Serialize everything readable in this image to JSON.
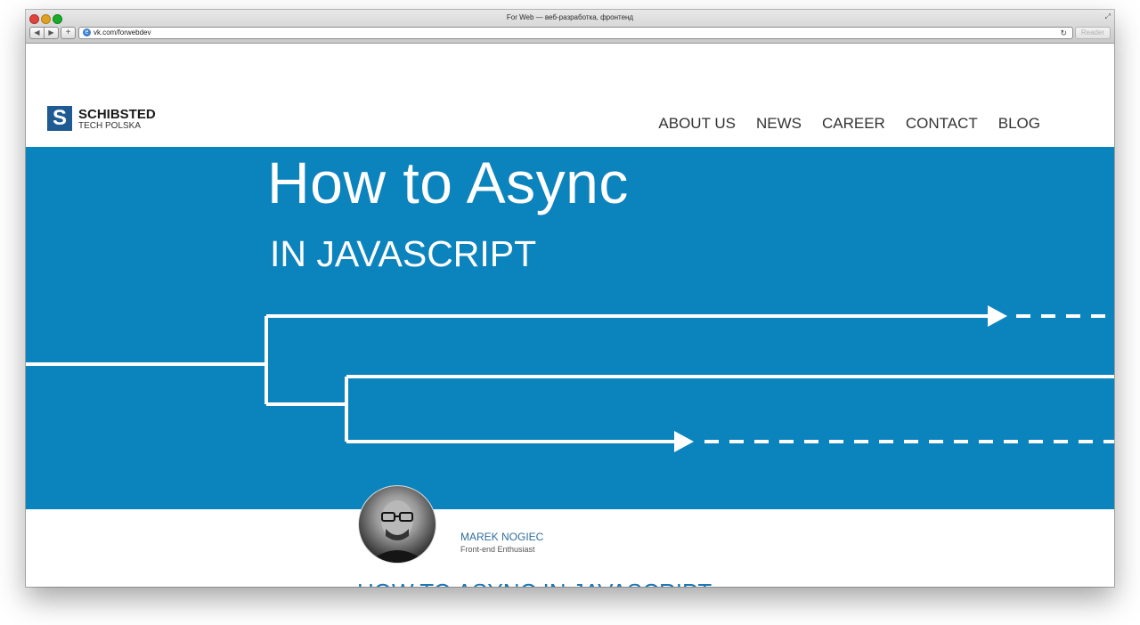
{
  "browser": {
    "window_title": "For Web — веб-разработка, фронтенд",
    "url": "vk.com/forwebdev",
    "reader_label": "Reader",
    "back_glyph": "◀",
    "forward_glyph": "▶",
    "add_glyph": "+",
    "reload_glyph": "↻",
    "fullscreen_glyph": "⤢"
  },
  "logo": {
    "mark": "S",
    "name": "SCHIBSTED",
    "subtitle": "TECH POLSKA"
  },
  "nav": {
    "items": [
      "ABOUT US",
      "NEWS",
      "CAREER",
      "CONTACT",
      "BLOG"
    ]
  },
  "hero": {
    "title": "How to Async",
    "subtitle": "IN JAVASCRIPT"
  },
  "author": {
    "name": "MAREK NOGIEC",
    "role": "Front-end Enthusiast"
  },
  "article": {
    "title": "HOW TO ASYNC IN JAVASCRIPT"
  },
  "colors": {
    "hero_background": "#0b83bd",
    "brand_blue": "#1f5a92",
    "link_blue": "#2d6e9e"
  }
}
